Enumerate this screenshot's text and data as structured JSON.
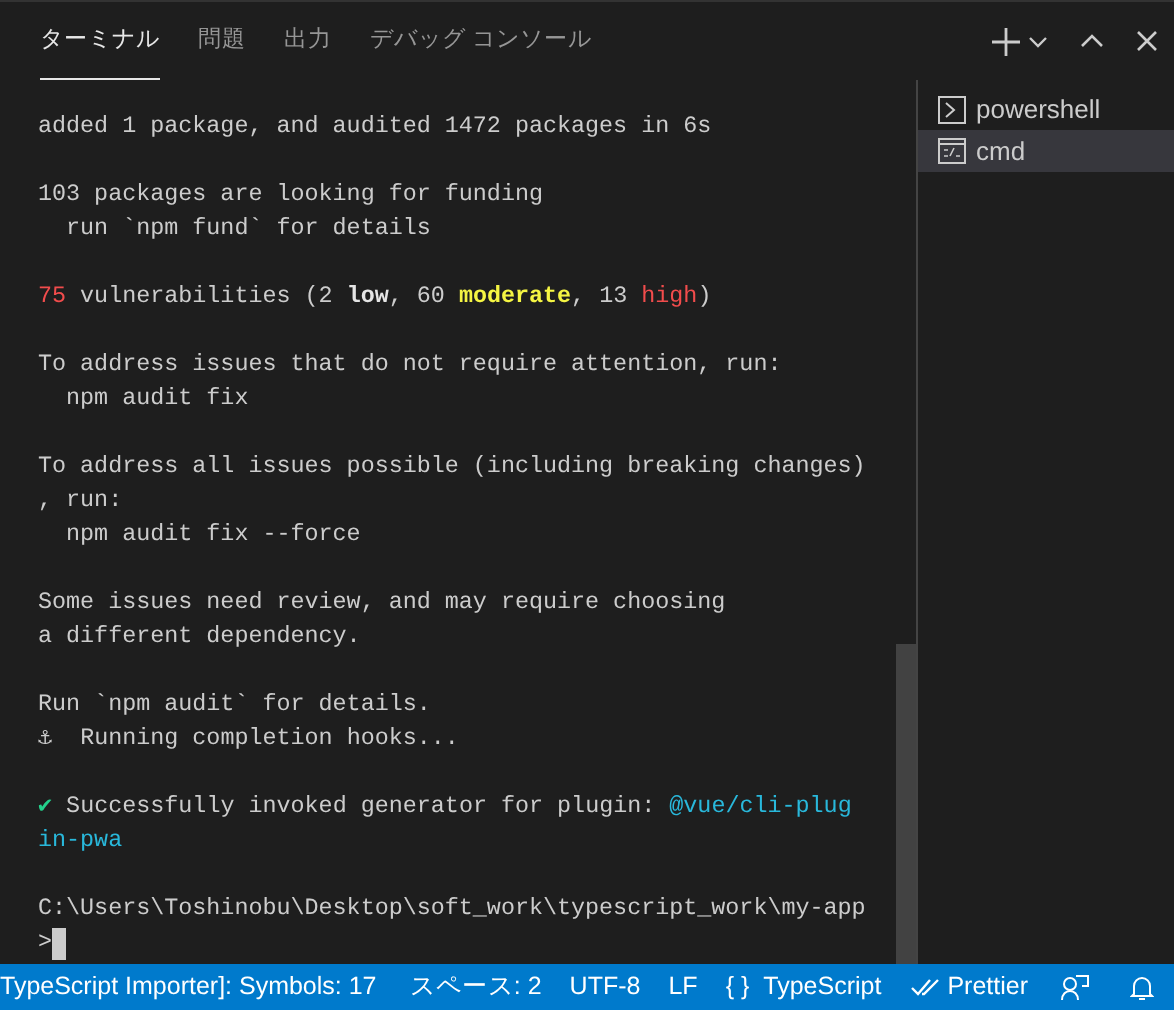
{
  "tabs": [
    {
      "label": "ターミナル",
      "selected": true
    },
    {
      "label": "問題",
      "selected": false
    },
    {
      "label": "出力",
      "selected": false
    },
    {
      "label": "デバッグ コンソール",
      "selected": false
    }
  ],
  "terminal": {
    "paragraphs": [
      [
        "added 1 package, and audited 1472 packages in 6s"
      ],
      [
        "103 packages are looking for funding",
        "  run `npm fund` for details"
      ],
      [
        [
          {
            "text": "75",
            "kind": "total"
          },
          " vulnerabilities (2 ",
          {
            "text": "low",
            "kind": "severity_low"
          },
          ", 60 ",
          {
            "text": "moderate",
            "kind": "severity_moderate"
          },
          ", 13 ",
          {
            "text": "high",
            "kind": "severity_high"
          },
          ")"
        ]
      ],
      [
        "To address issues that do not require attention, run:",
        "  npm audit fix"
      ],
      [
        "To address all issues possible (including breaking changes)",
        ", run:",
        "  npm audit fix --force"
      ],
      [
        "Some issues need review, and may require choosing",
        "a different dependency."
      ],
      [
        "Run `npm audit` for details.",
        "⚓  Running completion hooks..."
      ],
      [
        [
          {
            "text": "✔",
            "kind": "success"
          },
          " Successfully invoked generator for plugin: ",
          {
            "text": "@vue/cli-plug",
            "kind": "package"
          }
        ],
        [
          {
            "text": "in-pwa",
            "kind": "package"
          }
        ]
      ],
      [
        "C:\\Users\\Toshinobu\\Desktop\\soft_work\\typescript_work\\my-app",
        ">"
      ]
    ]
  },
  "shells": [
    {
      "name": "powershell",
      "kind": "prompt",
      "selected": false
    },
    {
      "name": "cmd",
      "kind": "cmd",
      "selected": true
    }
  ],
  "status_bar": [
    {
      "text": "TypeScript Importer]: Symbols: 17",
      "kind": "text"
    },
    {
      "text": "スペース: 2",
      "kind": "text"
    },
    {
      "text": "UTF-8",
      "kind": "text"
    },
    {
      "text": "LF",
      "kind": "text"
    },
    {
      "text": "{ }",
      "kind": "text"
    },
    {
      "text": "TypeScript",
      "kind": "text"
    },
    {
      "text": "Prettier",
      "kind": "prettier"
    },
    {
      "kind": "feedback"
    },
    {
      "kind": "bell"
    }
  ]
}
